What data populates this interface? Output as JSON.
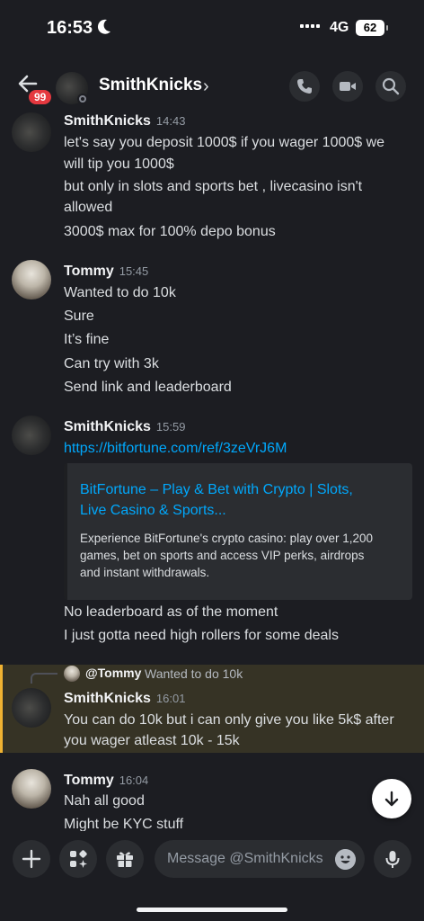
{
  "status_bar": {
    "time": "16:53",
    "network": "4G",
    "battery": "62"
  },
  "header": {
    "unread_badge": "99",
    "channel_name": "SmithKnicks",
    "chevron": "›"
  },
  "messages": [
    {
      "author": "SmithKnicks",
      "time": "14:43",
      "lines": [
        "let's say you deposit 1000$ if you wager 1000$ we",
        "will tip you 1000$",
        "but only in slots and sports bet , livecasino isn't",
        "allowed",
        "3000$ max for 100% depo bonus"
      ]
    },
    {
      "author": "Tommy",
      "time": "15:45",
      "lines": [
        "Wanted to do 10k",
        "Sure",
        "It’s fine",
        "Can try with 3k",
        "Send link and leaderboard"
      ]
    },
    {
      "author": "SmithKnicks",
      "time": "15:59",
      "link": "https://bitfortune.com/ref/3zeVrJ6M",
      "embed": {
        "title_lines": [
          "BitFortune – Play & Bet with Crypto | Slots,",
          "Live Casino & Sports..."
        ],
        "description_lines": [
          "Experience BitFortune's crypto casino: play over 1,200",
          "games, bet on sports and access VIP perks, airdrops",
          "and instant withdrawals."
        ]
      },
      "lines": [
        "No leaderboard as of the moment",
        "I just gotta need high rollers for some deals"
      ]
    },
    {
      "author": "SmithKnicks",
      "time": "16:01",
      "reply": {
        "mention": "@Tommy",
        "text": "Wanted to do 10k"
      },
      "lines": [
        "You can do 10k but i can only give you like 5k$ after",
        "you wager atleast 10k - 15k"
      ]
    },
    {
      "author": "Tommy",
      "time": "16:04",
      "lines": [
        "Nah all good",
        "Might be KYC stuff"
      ]
    }
  ],
  "composer": {
    "placeholder": "Message @SmithKnicks"
  },
  "colors": {
    "background": "#1c1d22",
    "link": "#00a8fc",
    "mention_highlight": "#f0b232",
    "badge": "#e5383f"
  }
}
